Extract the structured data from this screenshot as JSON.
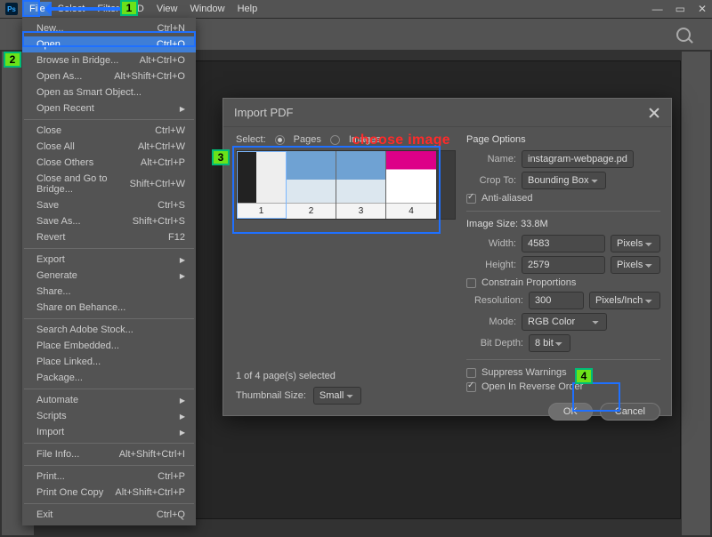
{
  "menubar": {
    "items": [
      "File",
      "Select",
      "Filter",
      "3D",
      "View",
      "Window",
      "Help"
    ],
    "activeIndex": 0
  },
  "fileMenu": {
    "groups": [
      [
        {
          "label": "New...",
          "shortcut": "Ctrl+N"
        },
        {
          "label": "Open...",
          "shortcut": "Ctrl+O",
          "highlight": true
        },
        {
          "label": "Browse in Bridge...",
          "shortcut": "Alt+Ctrl+O"
        },
        {
          "label": "Open As...",
          "shortcut": "Alt+Shift+Ctrl+O"
        },
        {
          "label": "Open as Smart Object..."
        },
        {
          "label": "Open Recent",
          "submenu": true
        }
      ],
      [
        {
          "label": "Close",
          "shortcut": "Ctrl+W"
        },
        {
          "label": "Close All",
          "shortcut": "Alt+Ctrl+W"
        },
        {
          "label": "Close Others",
          "shortcut": "Alt+Ctrl+P"
        },
        {
          "label": "Close and Go to Bridge...",
          "shortcut": "Shift+Ctrl+W"
        },
        {
          "label": "Save",
          "shortcut": "Ctrl+S"
        },
        {
          "label": "Save As...",
          "shortcut": "Shift+Ctrl+S"
        },
        {
          "label": "Revert",
          "shortcut": "F12"
        }
      ],
      [
        {
          "label": "Export",
          "submenu": true
        },
        {
          "label": "Generate",
          "submenu": true
        },
        {
          "label": "Share..."
        },
        {
          "label": "Share on Behance..."
        }
      ],
      [
        {
          "label": "Search Adobe Stock..."
        },
        {
          "label": "Place Embedded..."
        },
        {
          "label": "Place Linked..."
        },
        {
          "label": "Package..."
        }
      ],
      [
        {
          "label": "Automate",
          "submenu": true
        },
        {
          "label": "Scripts",
          "submenu": true
        },
        {
          "label": "Import",
          "submenu": true
        }
      ],
      [
        {
          "label": "File Info...",
          "shortcut": "Alt+Shift+Ctrl+I"
        }
      ],
      [
        {
          "label": "Print...",
          "shortcut": "Ctrl+P"
        },
        {
          "label": "Print One Copy",
          "shortcut": "Alt+Shift+Ctrl+P"
        }
      ],
      [
        {
          "label": "Exit",
          "shortcut": "Ctrl+Q"
        }
      ]
    ]
  },
  "dialog": {
    "title": "Import PDF",
    "selectLabel": "Select:",
    "radioPages": "Pages",
    "radioImages": "Images",
    "radioSelected": "pages",
    "chooseImage": "choose image",
    "thumbs": [
      "1",
      "2",
      "3",
      "4"
    ],
    "selectedThumb": 0,
    "selectedCountText": "1 of 4 page(s) selected",
    "thumbSizeLabel": "Thumbnail Size:",
    "thumbSizeValue": "Small",
    "pageOptionsTitle": "Page Options",
    "nameLabel": "Name:",
    "nameValue": "instagram-webpage.pdf",
    "cropLabel": "Crop To:",
    "cropValue": "Bounding Box",
    "antiAliased": {
      "label": "Anti-aliased",
      "checked": true
    },
    "imageSizeTitle": "Image Size: 33.8M",
    "widthLabel": "Width:",
    "widthValue": "4583",
    "widthUnit": "Pixels",
    "heightLabel": "Height:",
    "heightValue": "2579",
    "heightUnit": "Pixels",
    "constrain": {
      "label": "Constrain Proportions",
      "checked": false
    },
    "resolutionLabel": "Resolution:",
    "resolutionValue": "300",
    "resolutionUnit": "Pixels/Inch",
    "modeLabel": "Mode:",
    "modeValue": "RGB Color",
    "bitDepthLabel": "Bit Depth:",
    "bitDepthValue": "8 bit",
    "suppress": {
      "label": "Suppress Warnings",
      "checked": false
    },
    "reverse": {
      "label": "Open In Reverse Order",
      "checked": true
    },
    "okLabel": "OK",
    "cancelLabel": "Cancel"
  },
  "callouts": {
    "b1": "1",
    "b2": "2",
    "b3": "3",
    "b4": "4"
  }
}
